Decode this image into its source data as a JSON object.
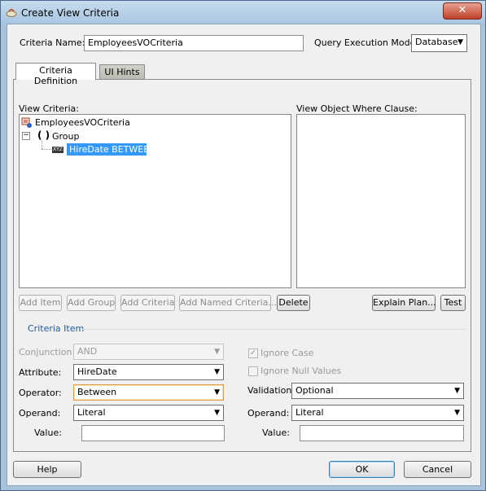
{
  "window": {
    "title": "Create View Criteria"
  },
  "header": {
    "criteria_name_label": "Criteria Name:",
    "criteria_name_value": "EmployeesVOCriteria",
    "query_mode_label": "Query Execution Mode:",
    "query_mode_value": "Database"
  },
  "tabs": [
    {
      "label": "Criteria Definition",
      "active": true
    },
    {
      "label": "UI Hints",
      "active": false
    }
  ],
  "view_criteria": {
    "label": "View Criteria:",
    "tree": {
      "root": "EmployeesVOCriteria",
      "group": "Group",
      "group_symbol": "( )",
      "toggle": "−",
      "item_badge": "XYZ",
      "item": "HireDate BETWEEN"
    }
  },
  "where_clause": {
    "label": "View Object Where Clause:"
  },
  "buttons": {
    "add_item": "Add Item",
    "add_group": "Add Group",
    "add_criteria": "Add Criteria",
    "add_named_criteria": "Add Named Criteria...",
    "delete": "Delete",
    "explain_plan": "Explain Plan...",
    "test": "Test",
    "help": "Help",
    "ok": "OK",
    "cancel": "Cancel"
  },
  "criteria_item": {
    "section_title": "Criteria Item",
    "conjunction_label": "Conjunction:",
    "conjunction_value": "AND",
    "attribute_label": "Attribute:",
    "attribute_value": "HireDate",
    "operator_label": "Operator:",
    "operator_value": "Between",
    "operand_left_label": "Operand:",
    "operand_left_value": "Literal",
    "value_left_label": "Value:",
    "value_left": "",
    "ignore_case_label": "Ignore Case",
    "ignore_case_checked": true,
    "ignore_null_label": "Ignore Null Values",
    "ignore_null_checked": false,
    "validation_label": "Validation:",
    "validation_value": "Optional",
    "operand_right_label": "Operand:",
    "operand_right_value": "Literal",
    "value_right_label": "Value:",
    "value_right": ""
  },
  "colors": {
    "selection": "#3399ff",
    "section_title": "#1e5aa8",
    "title_bar": "#b9d1ea"
  },
  "icons": {
    "app": "oracle-jdev-icon",
    "close": "close-icon",
    "root": "view-criteria-icon",
    "combo_arrow": "chevron-down-icon"
  }
}
